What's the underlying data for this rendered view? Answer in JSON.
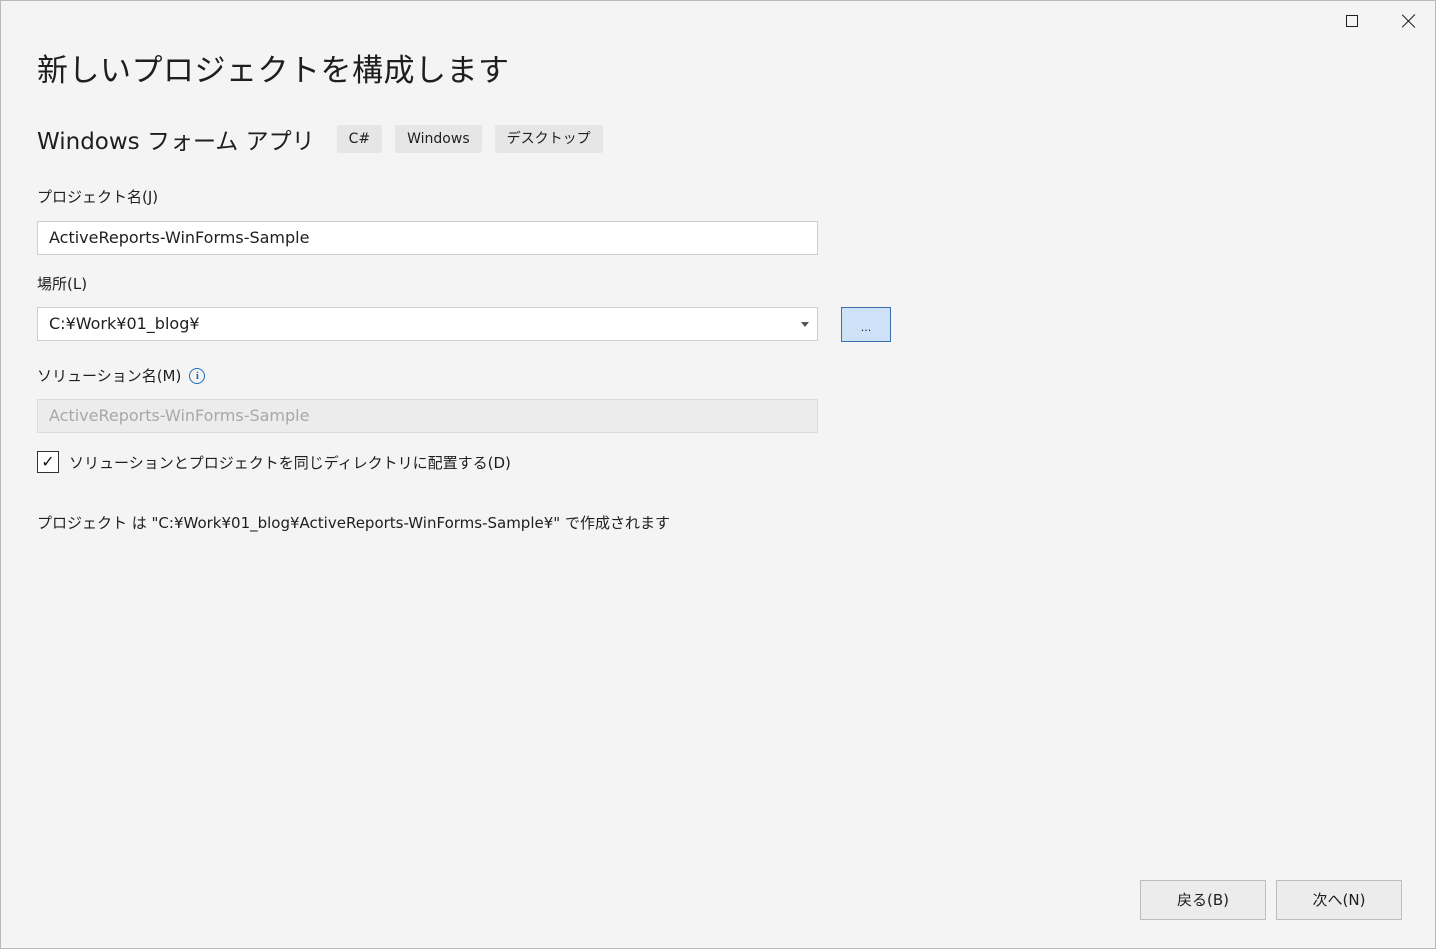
{
  "window": {
    "maximize_icon": "maximize-icon",
    "close_icon": "close-icon"
  },
  "title": "新しいプロジェクトを構成します",
  "template": {
    "name": "Windows フォーム アプリ",
    "tags": [
      "C#",
      "Windows",
      "デスクトップ"
    ]
  },
  "project_name": {
    "label": "プロジェクト名(J)",
    "value": "ActiveReports-WinForms-Sample"
  },
  "location": {
    "label": "場所(L)",
    "value": "C:¥Work¥01_blog¥",
    "browse_label": "..."
  },
  "solution_name": {
    "label": "ソリューション名(M)",
    "value": "ActiveReports-WinForms-Sample",
    "info_icon": "info-icon"
  },
  "same_directory": {
    "checked": true,
    "check_glyph": "✓",
    "label": "ソリューションとプロジェクトを同じディレクトリに配置する(D)"
  },
  "summary": "プロジェクト は \"C:¥Work¥01_blog¥ActiveReports-WinForms-Sample¥\" で作成されます",
  "buttons": {
    "back": "戻る(B)",
    "next": "次へ(N)"
  },
  "colors": {
    "background": "#f4f4f4",
    "browse_button": "#cde1f7",
    "accent": "#1a6fbd"
  }
}
